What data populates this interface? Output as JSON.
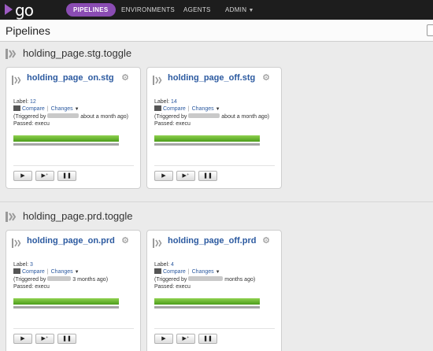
{
  "nav": {
    "logo_text": "go",
    "items": [
      "PIPELINES",
      "ENVIRONMENTS",
      "AGENTS",
      "ADMIN"
    ]
  },
  "page": {
    "title": "Pipelines"
  },
  "groups": [
    {
      "name": "holding_page.stg.toggle",
      "pipelines": [
        {
          "name": "holding_page_on.stg",
          "label_prefix": "Label:",
          "label": "12",
          "compare": "Compare",
          "changes": "Changes",
          "triggered_prefix": "(Triggered by",
          "triggered_suffix": "about a month ago)",
          "passed": "Passed: execu"
        },
        {
          "name": "holding_page_off.stg",
          "label_prefix": "Label:",
          "label": "14",
          "compare": "Compare",
          "changes": "Changes",
          "triggered_prefix": "(Triggered by",
          "triggered_suffix": "about a month ago)",
          "passed": "Passed: execu"
        }
      ]
    },
    {
      "name": "holding_page.prd.toggle",
      "pipelines": [
        {
          "name": "holding_page_on.prd",
          "label_prefix": "Label:",
          "label": "3",
          "compare": "Compare",
          "changes": "Changes",
          "triggered_prefix": "(Triggered by",
          "triggered_suffix": "3 months ago)",
          "passed": "Passed: execu"
        },
        {
          "name": "holding_page_off.prd",
          "label_prefix": "Label:",
          "label": "4",
          "compare": "Compare",
          "changes": "Changes",
          "triggered_prefix": "(Triggered by",
          "triggered_suffix": "months ago)",
          "passed": "Passed: execu"
        }
      ]
    }
  ],
  "buttons": {
    "trigger": "▶",
    "trigger_with_options": "▶⁺",
    "pause": "❚❚"
  },
  "colors": {
    "accent": "#8a4cb3",
    "link": "#2c5aa0",
    "passed": "#6bbf2e"
  },
  "icons": {
    "pipeline": "pipeline-chevrons-icon",
    "settings": "gear-icon",
    "compare": "compare-icon"
  }
}
